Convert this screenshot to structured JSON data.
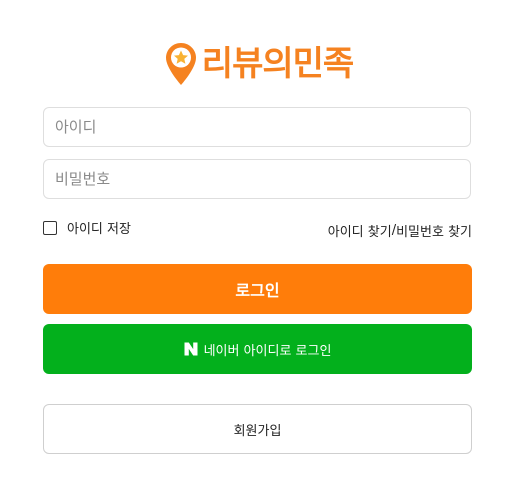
{
  "brand": {
    "name": "리뷰의민족",
    "color": "#f58220",
    "icon": "map-pin-star-icon"
  },
  "login_form": {
    "id_placeholder": "아이디",
    "pw_placeholder": "비밀번호",
    "remember_label": "아이디 저장",
    "find_id_label": "아이디 찾기",
    "find_separator": " /",
    "find_pw_label": "비밀번호 찾기",
    "login_button": "로그인",
    "naver_button": "네이버 아이디로 로그인",
    "signup_button": "회원가입"
  },
  "colors": {
    "login_button": "#ff7d0a",
    "naver_button": "#03b01c",
    "border": "#dedede"
  }
}
